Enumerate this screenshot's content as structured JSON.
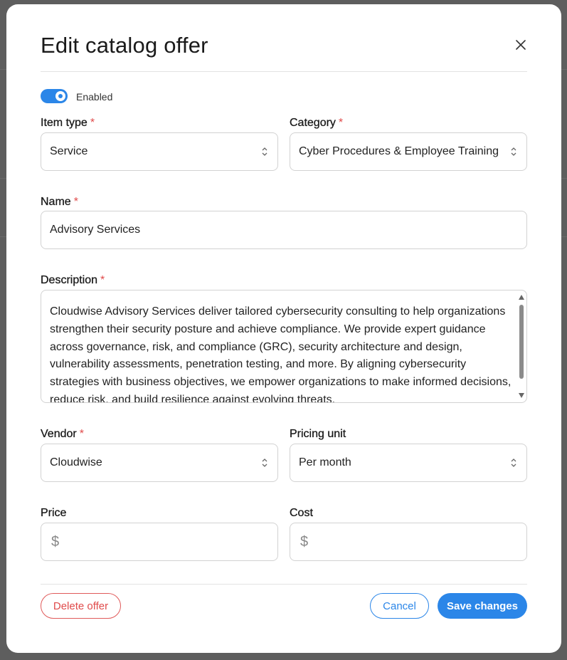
{
  "modal": {
    "title": "Edit catalog offer",
    "enabled_label": "Enabled",
    "enabled": true
  },
  "fields": {
    "item_type": {
      "label": "Item type",
      "value": "Service"
    },
    "category": {
      "label": "Category",
      "value": "Cyber Procedures & Employee Training"
    },
    "name": {
      "label": "Name",
      "value": "Advisory Services"
    },
    "description": {
      "label": "Description",
      "value": "Cloudwise Advisory Services deliver tailored cybersecurity consulting to help organizations strengthen their security posture and achieve compliance. We provide expert guidance across governance, risk, and compliance (GRC), security architecture and design, vulnerability assessments, penetration testing, and more. By aligning cybersecurity strategies with business objectives, we empower organizations to make informed decisions, reduce risk, and build resilience against evolving threats."
    },
    "vendor": {
      "label": "Vendor",
      "value": "Cloudwise"
    },
    "pricing_unit": {
      "label": "Pricing unit",
      "value": "Per month"
    },
    "price": {
      "label": "Price",
      "prefix": "$",
      "value": ""
    },
    "cost": {
      "label": "Cost",
      "prefix": "$",
      "value": ""
    },
    "required_marker": "*"
  },
  "buttons": {
    "delete": "Delete offer",
    "cancel": "Cancel",
    "save": "Save changes"
  },
  "colors": {
    "accent": "#2b86e8",
    "danger": "#e04b4b"
  }
}
